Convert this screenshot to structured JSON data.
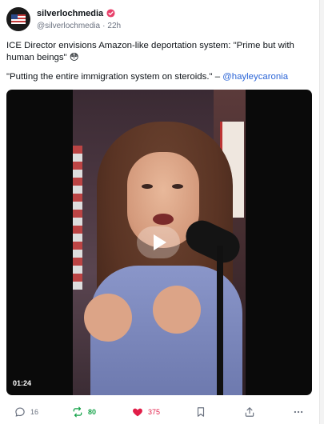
{
  "post": {
    "display_name": "silverlochmedia",
    "handle": "@silverlochmedia",
    "separator": "·",
    "time": "22h",
    "text_line1": "ICE Director envisions Amazon-like deportation system: \"Prime but with human beings\" 😳",
    "text_line2_prefix": "\"Putting the entire immigration system on steroids.\" – ",
    "mention": "@hayleycaronia"
  },
  "video": {
    "duration": "01:24"
  },
  "actions": {
    "reply_count": "16",
    "repost_count": "80",
    "like_count": "375"
  },
  "colors": {
    "accent_link": "#2a64d6",
    "repost_active": "#16a34a",
    "like_active": "#e11d48",
    "verified_badge": "#e8416b"
  }
}
